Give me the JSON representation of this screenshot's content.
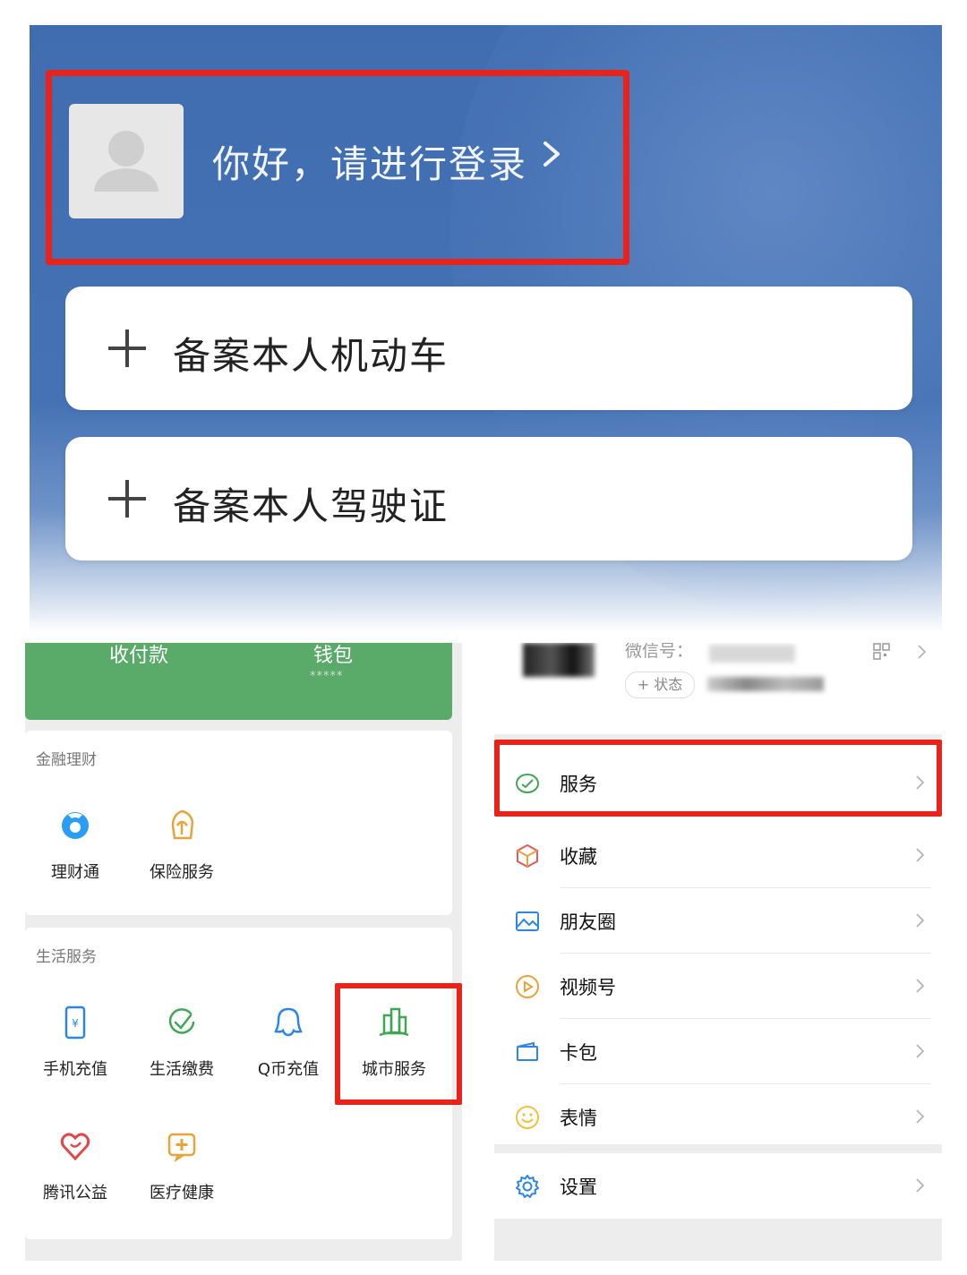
{
  "top": {
    "login_prompt": "你好，请进行登录",
    "cards": [
      {
        "label": "备案本人机动车"
      },
      {
        "label": "备案本人驾驶证"
      }
    ]
  },
  "wallet": {
    "bar": {
      "pay_label": "收付款",
      "wallet_label": "钱包",
      "balance_mask": "*****"
    },
    "sections": [
      {
        "title": "金融理财",
        "items": [
          {
            "label": "理财通",
            "icon": "licaitong-icon"
          },
          {
            "label": "保险服务",
            "icon": "insurance-icon"
          }
        ]
      },
      {
        "title": "生活服务",
        "items": [
          {
            "label": "手机充值",
            "icon": "phone-recharge-icon"
          },
          {
            "label": "生活缴费",
            "icon": "utility-payment-icon"
          },
          {
            "label": "Q币充值",
            "icon": "qcoin-icon"
          },
          {
            "label": "城市服务",
            "icon": "city-service-icon"
          },
          {
            "label": "腾讯公益",
            "icon": "charity-icon"
          },
          {
            "label": "医疗健康",
            "icon": "medical-icon"
          }
        ]
      }
    ]
  },
  "me": {
    "wechat_id_label": "微信号：",
    "status_label": "+ 状态",
    "menu": [
      {
        "label": "服务",
        "icon": "service-icon"
      },
      {
        "label": "收藏",
        "icon": "favorites-icon"
      },
      {
        "label": "朋友圈",
        "icon": "moments-icon"
      },
      {
        "label": "视频号",
        "icon": "channels-icon"
      },
      {
        "label": "卡包",
        "icon": "card-wallet-icon"
      },
      {
        "label": "表情",
        "icon": "sticker-icon"
      }
    ],
    "settings_label": "设置"
  },
  "colors": {
    "highlight": "#e8231c",
    "wechat_green": "#5aaa69",
    "header_blue": "#4572b4"
  }
}
